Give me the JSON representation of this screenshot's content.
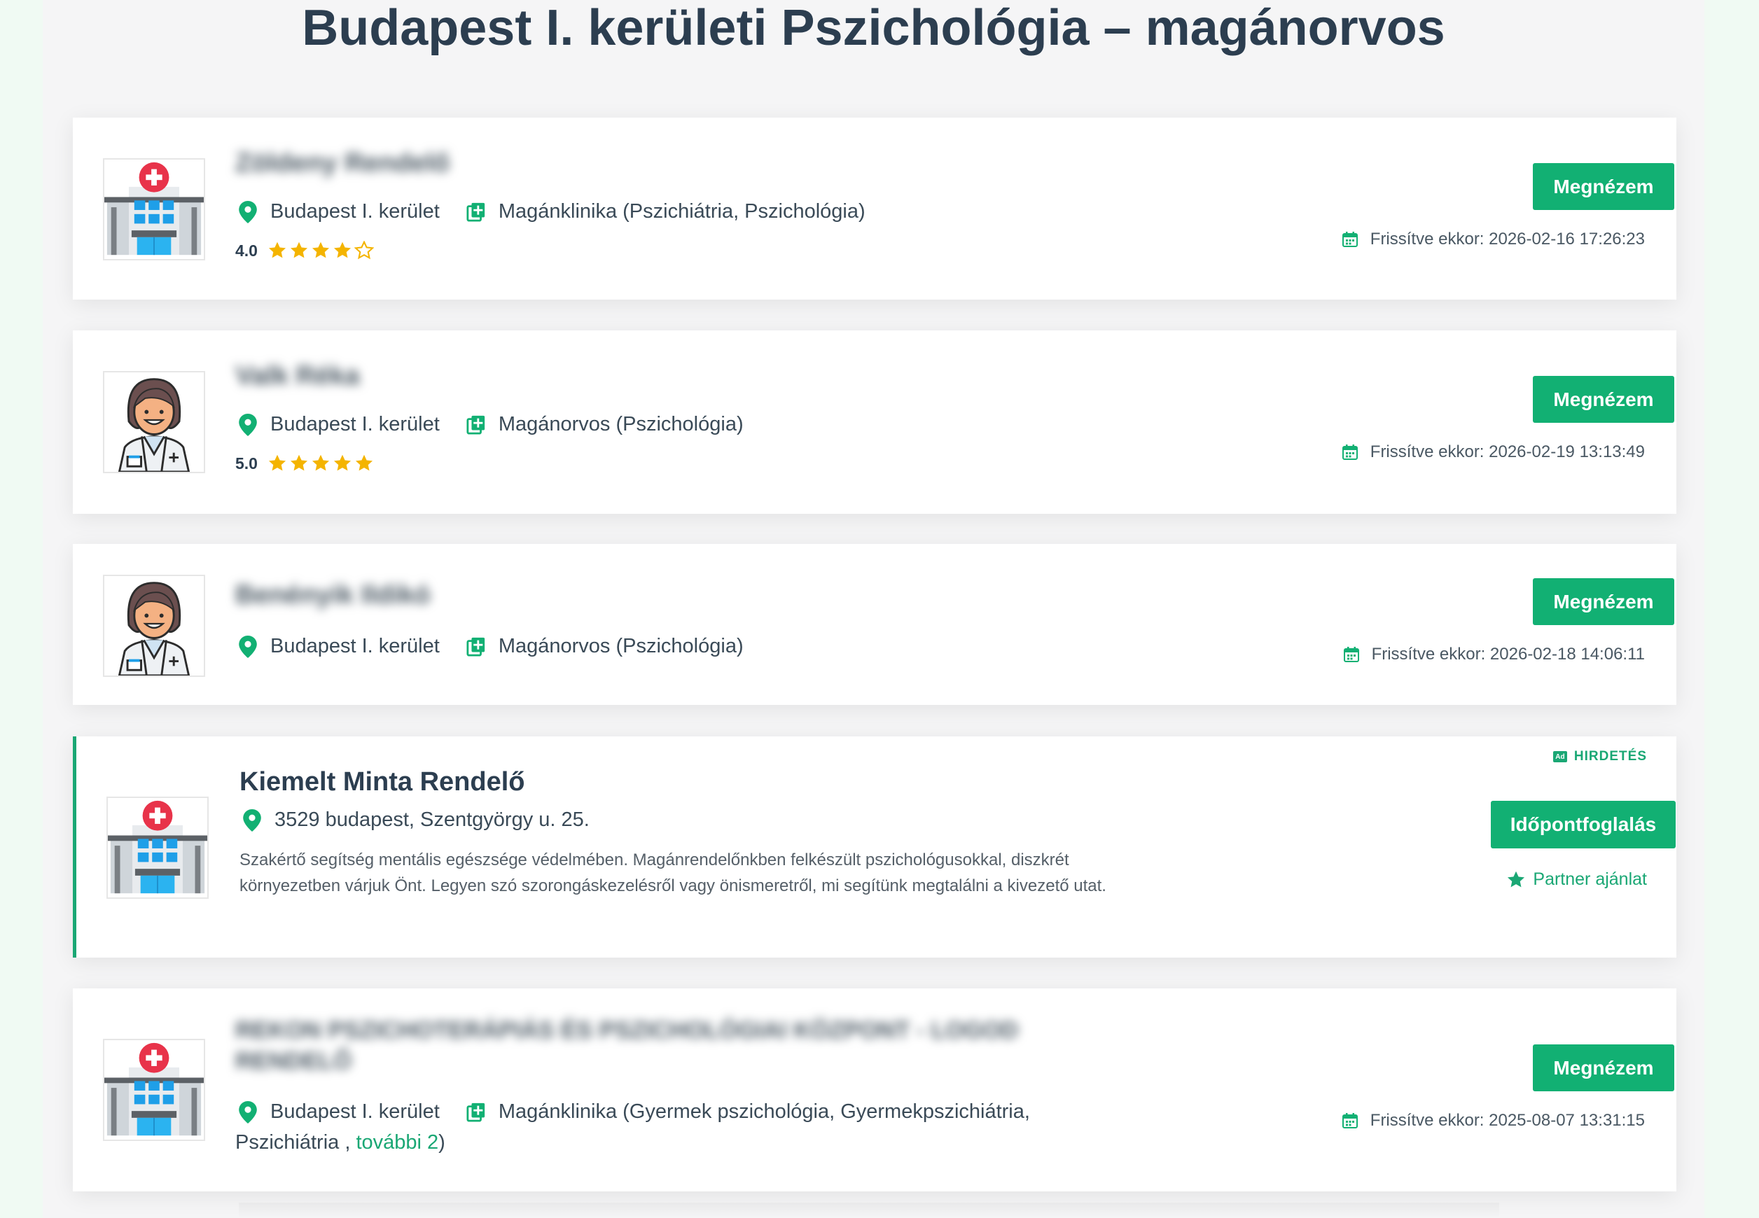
{
  "page_title": "Budapest I. kerületi Pszichológia – magánorvos",
  "colors": {
    "accent": "#12b073",
    "star": "#f4b400",
    "text": "#2c3e50"
  },
  "listings": [
    {
      "name": "Zöldeny Rendelő",
      "avatar": "hospital-icon",
      "location": "Budapest I. kerület",
      "category": "Magánklinika (Pszichiátria, Pszichológia)",
      "rating": "4.0",
      "stars": 4,
      "button": "Megnézem",
      "updated": "Frissítve ekkor: 2026-02-16 17:26:23"
    },
    {
      "name": "Valk Réka",
      "avatar": "female-doctor-icon",
      "location": "Budapest I. kerület",
      "category": "Magánorvos (Pszichológia)",
      "rating": "5.0",
      "stars": 5,
      "button": "Megnézem",
      "updated": "Frissítve ekkor: 2026-02-19 13:13:49"
    },
    {
      "name": "Benényik Ildikó",
      "avatar": "female-doctor-icon",
      "location": "Budapest I. kerület",
      "category": "Magánorvos (Pszichológia)",
      "button": "Megnézem",
      "updated": "Frissítve ekkor: 2026-02-18 14:06:11"
    },
    {
      "name": "REKON PSZICHOTERÁPIÁS ÉS PSZICHOLÓGIAI KÖZPONT - LOGOD RENDELŐ",
      "avatar": "hospital-icon",
      "location": "Budapest I. kerület",
      "category_line1": "Magánklinika (Gyermek pszichológia, Gyermekpszichiátria,",
      "category_line2_pre": "Pszichiátria ,",
      "category_more": "további 2",
      "category_line2_post": ")",
      "button": "Megnézem",
      "updated": "Frissítve ekkor: 2025-08-07 13:31:15"
    }
  ],
  "featured": {
    "badge_box": "Ad",
    "badge": "HIRDETÉS",
    "name": "Kiemelt Minta Rendelő",
    "address": "3529 budapest, Szentgyörgy u. 25.",
    "description": "Szakértő segítség mentális egészsége védelmében. Magánrendelőnkben felkészült pszichológusokkal, diszkrét környezetben várjuk Önt. Legyen szó szorongáskezelésről vagy önismeretről, mi segítünk megtalálni a kivezető utat.",
    "button": "Időpontfoglalás",
    "partner": "Partner ajánlat"
  }
}
